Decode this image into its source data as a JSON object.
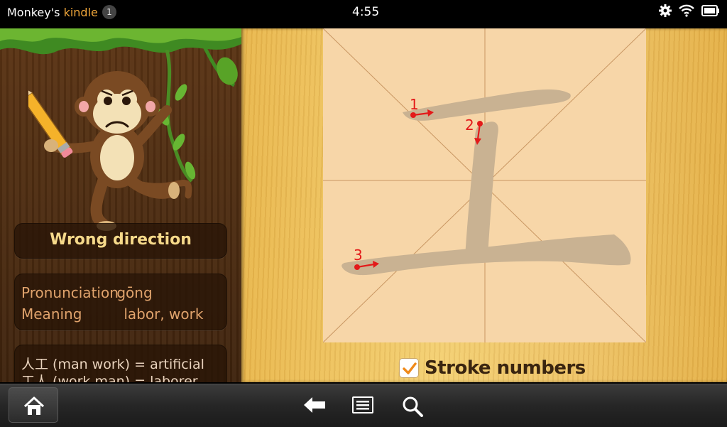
{
  "status_bar": {
    "device_owner": "Monkey's",
    "device_brand": "kindle",
    "notification_count": "1",
    "time": "4:55"
  },
  "feedback": {
    "message": "Wrong direction"
  },
  "character_info": {
    "pronunciation_label": "Pronunciation",
    "pronunciation_value": "gōng",
    "meaning_label": "Meaning",
    "meaning_value": "labor, work"
  },
  "examples": [
    "人工 (man work) = artificial",
    "工人 (work man) = laborer"
  ],
  "stroke_markers": [
    "1",
    "2",
    "3"
  ],
  "stroke_numbers_option": {
    "label": "Stroke numbers",
    "checked": true
  },
  "icons": {
    "settings": "gear-icon",
    "wifi": "wifi-icon",
    "battery": "battery-icon",
    "home": "home-icon",
    "back": "back-arrow-icon",
    "menu": "menu-icon",
    "search": "search-icon"
  },
  "colors": {
    "brand": "#f0a63a",
    "stroke_guide": "#c9b292",
    "marker": "#e31a1a",
    "status_text": "#f6d98a"
  }
}
